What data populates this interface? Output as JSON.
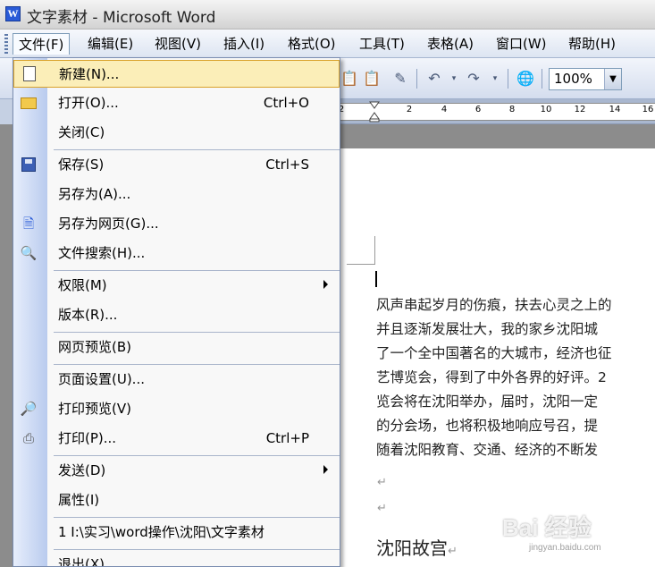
{
  "window": {
    "title": "文字素材 - Microsoft Word",
    "app_icon_letter": "W"
  },
  "menubar": {
    "items": [
      {
        "label": "文件(F)",
        "active": true
      },
      {
        "label": "编辑(E)"
      },
      {
        "label": "视图(V)"
      },
      {
        "label": "插入(I)"
      },
      {
        "label": "格式(O)"
      },
      {
        "label": "工具(T)"
      },
      {
        "label": "表格(A)"
      },
      {
        "label": "窗口(W)"
      },
      {
        "label": "帮助(H)"
      }
    ]
  },
  "toolbar": {
    "zoom": "100%",
    "icons": [
      "paste-icon",
      "format-painter-icon",
      "undo-icon",
      "redo-icon",
      "hyperlink-icon"
    ]
  },
  "ruler": {
    "ticks": [
      "2",
      "2",
      "4",
      "6",
      "8",
      "10",
      "12",
      "14",
      "16"
    ]
  },
  "file_menu": {
    "items": [
      {
        "label": "新建(N)...",
        "icon": "new-document-icon",
        "highlighted": true
      },
      {
        "label": "打开(O)...",
        "shortcut": "Ctrl+O",
        "icon": "open-folder-icon"
      },
      {
        "label": "关闭(C)"
      },
      {
        "label": "保存(S)",
        "shortcut": "Ctrl+S",
        "icon": "save-icon"
      },
      {
        "label": "另存为(A)..."
      },
      {
        "label": "另存为网页(G)...",
        "icon": "save-as-web-icon"
      },
      {
        "label": "文件搜索(H)...",
        "icon": "file-search-icon"
      },
      {
        "label": "权限(M)",
        "submenu": true
      },
      {
        "label": "版本(R)..."
      },
      {
        "label": "网页预览(B)"
      },
      {
        "label": "页面设置(U)..."
      },
      {
        "label": "打印预览(V)",
        "icon": "print-preview-icon"
      },
      {
        "label": "打印(P)...",
        "shortcut": "Ctrl+P",
        "icon": "printer-icon"
      },
      {
        "label": "发送(D)",
        "submenu": true
      },
      {
        "label": "属性(I)"
      },
      {
        "label": "1 I:\\实习\\word操作\\沈阳\\文字素材"
      },
      {
        "label": "退出(X)"
      }
    ]
  },
  "document": {
    "lines": [
      "风声串起岁月的伤痕，扶去心灵之上的",
      "并且逐渐发展壮大，我的家乡沈阳城",
      "了一个全中国著名的大城市，经济也征",
      "艺博览会，得到了中外各界的好评。2",
      "览会将在沈阳举办，届时，沈阳一定",
      "的分会场，也将积极地响应号召，提",
      "随着沈阳教育、交通、经济的不断发"
    ],
    "paragraph_mark": "↵",
    "heading": "沈阳故宫"
  },
  "watermark": {
    "logo": "Bai 经验",
    "url": "jingyan.baidu.com"
  }
}
